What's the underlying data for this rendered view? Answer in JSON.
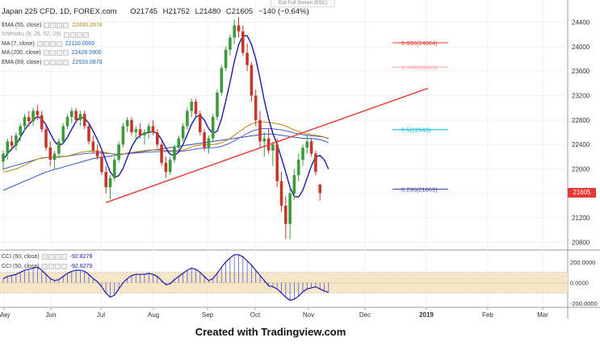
{
  "window": {
    "exit_fullscreen": "Exit Full Screen (ESC)"
  },
  "header": {
    "symbol": "Japan 225 CFD, 1D, FOREX.com",
    "open": "O21745",
    "high": "H21752",
    "low": "L21480",
    "close": "C21605",
    "change": "−140 (−0.64%)"
  },
  "legend": [
    {
      "label": "EMA (55, close)",
      "value": "22439.2974",
      "color": "#b8860b"
    },
    {
      "label": "Ichimoku (9, 26, 52, 26)",
      "value": "",
      "color": "#999999"
    },
    {
      "label": "MA (7, close)",
      "value": "22110.0000",
      "color": "#1565c0"
    },
    {
      "label": "MA (200, close)",
      "value": "22428.5900",
      "color": "#1565c0"
    },
    {
      "label": "EMA (89, close)",
      "value": "22533.0870",
      "color": "#1565c0"
    }
  ],
  "cci_legend": [
    {
      "label": "CCI (50, close)",
      "value": "-92.8279"
    },
    {
      "label": "CCI (50, close)",
      "value": "-92.8279"
    }
  ],
  "price_axis": [
    "24400",
    "24000",
    "23600",
    "23200",
    "22800",
    "22400",
    "22000",
    "21600",
    "21200",
    "20800"
  ],
  "cci_axis": [
    "200.0000",
    "0.0000",
    "-200.0000"
  ],
  "time_axis": [
    "May",
    "Jun",
    "Jul",
    "Aug",
    "Sep",
    "Oct",
    "Nov",
    "Dec",
    "2019",
    "Feb",
    "Mar"
  ],
  "last_price": "21605",
  "fibonacci": [
    {
      "label": "0.886(24064)",
      "value": 24064,
      "color": "#e53935"
    },
    {
      "label": "0.786(23665)",
      "value": 23665,
      "color": "#f4a6a6"
    },
    {
      "label": "0.5(22643)",
      "value": 22643,
      "color": "#00bcd4"
    },
    {
      "label": "0.236(21669)",
      "value": 21669,
      "color": "#3949ab"
    }
  ],
  "credit": "Created with Tradingview.com",
  "colors": {
    "up": "#3c9a3c",
    "down": "#c0392b",
    "trendline": "#e53935",
    "ma_fast": "#1a1aa6",
    "ema55": "#b8860b",
    "ma200": "#2a52be",
    "cci": "#1a1ab0",
    "cci_band": "#f5e6c8"
  },
  "chart_data": {
    "type": "candlestick",
    "ylim": [
      20700,
      24500
    ],
    "cci_ylim": [
      -230,
      300
    ],
    "candles": [
      {
        "o": 22120,
        "h": 22300,
        "l": 21980,
        "c": 22250
      },
      {
        "o": 22250,
        "h": 22500,
        "l": 22150,
        "c": 22450
      },
      {
        "o": 22450,
        "h": 22550,
        "l": 22300,
        "c": 22380
      },
      {
        "o": 22380,
        "h": 22600,
        "l": 22300,
        "c": 22550
      },
      {
        "o": 22550,
        "h": 22750,
        "l": 22450,
        "c": 22700
      },
      {
        "o": 22700,
        "h": 22900,
        "l": 22620,
        "c": 22850
      },
      {
        "o": 22850,
        "h": 22950,
        "l": 22700,
        "c": 22780
      },
      {
        "o": 22780,
        "h": 23000,
        "l": 22700,
        "c": 22950
      },
      {
        "o": 22950,
        "h": 23050,
        "l": 22800,
        "c": 22880
      },
      {
        "o": 22880,
        "h": 22950,
        "l": 22600,
        "c": 22650
      },
      {
        "o": 22650,
        "h": 22700,
        "l": 22300,
        "c": 22350
      },
      {
        "o": 22350,
        "h": 22450,
        "l": 22050,
        "c": 22150
      },
      {
        "o": 22150,
        "h": 22300,
        "l": 22000,
        "c": 22250
      },
      {
        "o": 22250,
        "h": 22500,
        "l": 22200,
        "c": 22450
      },
      {
        "o": 22450,
        "h": 22750,
        "l": 22400,
        "c": 22700
      },
      {
        "o": 22700,
        "h": 22900,
        "l": 22650,
        "c": 22850
      },
      {
        "o": 22850,
        "h": 23000,
        "l": 22750,
        "c": 22950
      },
      {
        "o": 22950,
        "h": 23000,
        "l": 22750,
        "c": 22800
      },
      {
        "o": 22800,
        "h": 22950,
        "l": 22700,
        "c": 22900
      },
      {
        "o": 22900,
        "h": 22950,
        "l": 22650,
        "c": 22700
      },
      {
        "o": 22700,
        "h": 22750,
        "l": 22400,
        "c": 22450
      },
      {
        "o": 22450,
        "h": 22550,
        "l": 22250,
        "c": 22300
      },
      {
        "o": 22300,
        "h": 22400,
        "l": 22150,
        "c": 22200
      },
      {
        "o": 22200,
        "h": 22350,
        "l": 21900,
        "c": 21950
      },
      {
        "o": 21950,
        "h": 22050,
        "l": 21600,
        "c": 21700
      },
      {
        "o": 21700,
        "h": 21900,
        "l": 21500,
        "c": 21850
      },
      {
        "o": 21850,
        "h": 22200,
        "l": 21800,
        "c": 22150
      },
      {
        "o": 22150,
        "h": 22450,
        "l": 22100,
        "c": 22400
      },
      {
        "o": 22400,
        "h": 22750,
        "l": 22350,
        "c": 22700
      },
      {
        "o": 22700,
        "h": 22850,
        "l": 22600,
        "c": 22800
      },
      {
        "o": 22800,
        "h": 22850,
        "l": 22550,
        "c": 22600
      },
      {
        "o": 22600,
        "h": 22700,
        "l": 22450,
        "c": 22650
      },
      {
        "o": 22650,
        "h": 22750,
        "l": 22500,
        "c": 22550
      },
      {
        "o": 22550,
        "h": 22650,
        "l": 22400,
        "c": 22600
      },
      {
        "o": 22600,
        "h": 22750,
        "l": 22500,
        "c": 22700
      },
      {
        "o": 22700,
        "h": 22800,
        "l": 22550,
        "c": 22600
      },
      {
        "o": 22600,
        "h": 22650,
        "l": 22350,
        "c": 22400
      },
      {
        "o": 22400,
        "h": 22450,
        "l": 22050,
        "c": 22100
      },
      {
        "o": 22100,
        "h": 22200,
        "l": 21850,
        "c": 21950
      },
      {
        "o": 21950,
        "h": 22200,
        "l": 21900,
        "c": 22150
      },
      {
        "o": 22150,
        "h": 22400,
        "l": 22100,
        "c": 22350
      },
      {
        "o": 22350,
        "h": 22550,
        "l": 22300,
        "c": 22500
      },
      {
        "o": 22500,
        "h": 22750,
        "l": 22450,
        "c": 22700
      },
      {
        "o": 22700,
        "h": 23000,
        "l": 22650,
        "c": 22950
      },
      {
        "o": 22950,
        "h": 23150,
        "l": 22850,
        "c": 23100
      },
      {
        "o": 23100,
        "h": 23150,
        "l": 22850,
        "c": 22900
      },
      {
        "o": 22900,
        "h": 22950,
        "l": 22550,
        "c": 22600
      },
      {
        "o": 22600,
        "h": 22650,
        "l": 22300,
        "c": 22350
      },
      {
        "o": 22350,
        "h": 22550,
        "l": 22250,
        "c": 22500
      },
      {
        "o": 22500,
        "h": 22900,
        "l": 22450,
        "c": 22850
      },
      {
        "o": 22850,
        "h": 23300,
        "l": 22800,
        "c": 23250
      },
      {
        "o": 23250,
        "h": 23700,
        "l": 23200,
        "c": 23650
      },
      {
        "o": 23650,
        "h": 24000,
        "l": 23600,
        "c": 23950
      },
      {
        "o": 23950,
        "h": 24200,
        "l": 23850,
        "c": 24150
      },
      {
        "o": 24150,
        "h": 24450,
        "l": 24050,
        "c": 24350
      },
      {
        "o": 24350,
        "h": 24480,
        "l": 24150,
        "c": 24250
      },
      {
        "o": 24250,
        "h": 24350,
        "l": 23850,
        "c": 23900
      },
      {
        "o": 23900,
        "h": 24050,
        "l": 23600,
        "c": 23700
      },
      {
        "o": 23700,
        "h": 23750,
        "l": 23100,
        "c": 23200
      },
      {
        "o": 23200,
        "h": 23300,
        "l": 22700,
        "c": 22800
      },
      {
        "o": 22800,
        "h": 22950,
        "l": 22350,
        "c": 22450
      },
      {
        "o": 22450,
        "h": 22600,
        "l": 22200,
        "c": 22500
      },
      {
        "o": 22500,
        "h": 22650,
        "l": 22250,
        "c": 22300
      },
      {
        "o": 22300,
        "h": 22450,
        "l": 22050,
        "c": 22400
      },
      {
        "o": 22400,
        "h": 22500,
        "l": 21700,
        "c": 21800
      },
      {
        "o": 21800,
        "h": 21950,
        "l": 21300,
        "c": 21400
      },
      {
        "o": 21400,
        "h": 21550,
        "l": 20850,
        "c": 21100
      },
      {
        "o": 21100,
        "h": 21700,
        "l": 20850,
        "c": 21600
      },
      {
        "o": 21600,
        "h": 22000,
        "l": 21500,
        "c": 21900
      },
      {
        "o": 21900,
        "h": 22250,
        "l": 21800,
        "c": 22150
      },
      {
        "o": 22150,
        "h": 22400,
        "l": 22050,
        "c": 22350
      },
      {
        "o": 22350,
        "h": 22550,
        "l": 22250,
        "c": 22450
      },
      {
        "o": 22450,
        "h": 22500,
        "l": 22200,
        "c": 22250
      },
      {
        "o": 22250,
        "h": 22300,
        "l": 21900,
        "c": 21950
      },
      {
        "o": 21745,
        "h": 21752,
        "l": 21480,
        "c": 21605
      }
    ],
    "ma_fast": [
      22150,
      22250,
      22330,
      22400,
      22520,
      22640,
      22730,
      22800,
      22860,
      22820,
      22720,
      22580,
      22450,
      22380,
      22420,
      22520,
      22650,
      22780,
      22850,
      22830,
      22750,
      22620,
      22480,
      22320,
      22130,
      21950,
      21860,
      21890,
      22010,
      22190,
      22360,
      22480,
      22550,
      22580,
      22600,
      22610,
      22580,
      22480,
      22340,
      22240,
      22220,
      22280,
      22400,
      22560,
      22730,
      22850,
      22880,
      22800,
      22660,
      22580,
      22620,
      22820,
      23110,
      23420,
      23760,
      24030,
      24180,
      24180,
      24040,
      23800,
      23480,
      23120,
      22820,
      22580,
      22400,
      22180,
      21950,
      21700,
      21550,
      21540,
      21650,
      21850,
      22050,
      22200,
      22220,
      22150,
      22000
    ],
    "ema55": [
      21950,
      21960,
      21980,
      22000,
      22030,
      22060,
      22100,
      22130,
      22160,
      22180,
      22190,
      22190,
      22190,
      22190,
      22200,
      22210,
      22230,
      22250,
      22270,
      22280,
      22290,
      22290,
      22290,
      22280,
      22270,
      22250,
      22240,
      22240,
      22240,
      22260,
      22270,
      22280,
      22290,
      22300,
      22310,
      22310,
      22310,
      22310,
      22300,
      22300,
      22300,
      22300,
      22310,
      22330,
      22360,
      22380,
      22390,
      22400,
      22400,
      22400,
      22410,
      22430,
      22460,
      22500,
      22550,
      22600,
      22650,
      22700,
      22740,
      22760,
      22770,
      22770,
      22760,
      22750,
      22740,
      22720,
      22700,
      22670,
      22640,
      22610,
      22590,
      22570,
      22560,
      22550,
      22540,
      22520,
      22490
    ],
    "ma200": [
      21650,
      21680,
      21710,
      21740,
      21770,
      21800,
      21830,
      21860,
      21890,
      21920,
      21950,
      21970,
      21990,
      22010,
      22030,
      22050,
      22070,
      22090,
      22110,
      22130,
      22150,
      22170,
      22180,
      22190,
      22200,
      22210,
      22220,
      22230,
      22240,
      22250,
      22260,
      22270,
      22280,
      22290,
      22300,
      22310,
      22320,
      22330,
      22340,
      22350,
      22360,
      22370,
      22380,
      22390,
      22400,
      22410,
      22420,
      22430,
      22440,
      22450,
      22460,
      22470,
      22480,
      22490,
      22500,
      22510,
      22520,
      22530,
      22540,
      22550,
      22560,
      22570,
      22570,
      22570,
      22560,
      22550,
      22540,
      22530,
      22520,
      22510,
      22500,
      22500,
      22500,
      22490,
      22480,
      22460,
      22430
    ],
    "ema89": [
      22000,
      22020,
      22040,
      22060,
      22080,
      22100,
      22120,
      22140,
      22160,
      22175,
      22185,
      22190,
      22195,
      22200,
      22205,
      22210,
      22220,
      22230,
      22240,
      22250,
      22255,
      22260,
      22260,
      22260,
      22255,
      22250,
      22245,
      22245,
      22245,
      22250,
      22255,
      22260,
      22265,
      22270,
      22275,
      22280,
      22282,
      22284,
      22284,
      22284,
      22285,
      22288,
      22292,
      22300,
      22312,
      22325,
      22335,
      22342,
      22345,
      22348,
      22355,
      22370,
      22395,
      22425,
      22460,
      22500,
      22540,
      22580,
      22615,
      22640,
      22655,
      22660,
      22660,
      22655,
      22648,
      22638,
      22625,
      22608,
      22590,
      22572,
      22560,
      22550,
      22542,
      22536,
      22530,
      22520,
      22500
    ],
    "cci": [
      40,
      60,
      70,
      80,
      100,
      120,
      130,
      140,
      150,
      120,
      80,
      40,
      20,
      30,
      60,
      90,
      110,
      120,
      120,
      110,
      80,
      40,
      10,
      -40,
      -100,
      -140,
      -120,
      -60,
      0,
      40,
      70,
      80,
      80,
      80,
      90,
      80,
      60,
      20,
      -20,
      -10,
      30,
      60,
      90,
      120,
      140,
      130,
      100,
      60,
      20,
      40,
      90,
      150,
      200,
      240,
      270,
      270,
      250,
      210,
      170,
      120,
      70,
      20,
      -30,
      -40,
      -60,
      -100,
      -140,
      -170,
      -160,
      -130,
      -90,
      -60,
      -50,
      -40,
      -60,
      -80,
      -93
    ]
  }
}
